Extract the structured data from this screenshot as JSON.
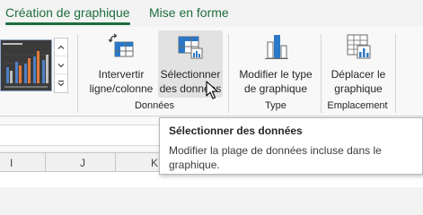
{
  "tabs": [
    {
      "label": "Création de graphique"
    },
    {
      "label": "Mise en forme"
    }
  ],
  "ribbon": {
    "buttons": {
      "switch_row_col": {
        "label_line1": "Intervertir",
        "label_line2": "ligne/colonne"
      },
      "select_data": {
        "label_line1": "Sélectionner",
        "label_line2": "des données"
      },
      "change_chart_type": {
        "label_line1": "Modifier le type",
        "label_line2": "de graphique"
      },
      "move_chart": {
        "label_line1": "Déplacer le",
        "label_line2": "graphique"
      }
    },
    "groups": {
      "data": "Données",
      "type": "Type",
      "location": "Emplacement"
    }
  },
  "tooltip": {
    "title": "Sélectionner des données",
    "body": "Modifier la plage de données incluse dans le graphique."
  },
  "column_headers": [
    "I",
    "J",
    "K"
  ],
  "colors": {
    "accent": "#1e6e3e",
    "icon_blue": "#2b78c6",
    "hover_bg": "#e2e2e2"
  }
}
